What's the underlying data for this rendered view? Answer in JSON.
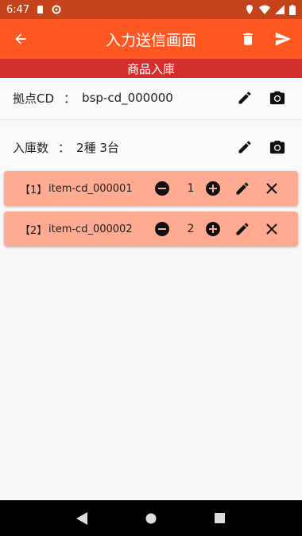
{
  "status_bar": {
    "time": "6:47",
    "icons": [
      "sd-card-icon",
      "data-saver-icon",
      "location-icon",
      "wifi-icon",
      "signal-icon",
      "battery-icon"
    ]
  },
  "app_bar": {
    "title": "入力送信画面",
    "back_icon": "arrow-back-icon",
    "delete_icon": "delete-icon",
    "send_icon": "send-icon",
    "color": "#ff5722"
  },
  "sub_header": {
    "title": "商品入庫",
    "color": "#d32f2f"
  },
  "base": {
    "label": "拠点CD",
    "colon": "：",
    "value": "bsp-cd_000000"
  },
  "stock": {
    "label": "入庫数",
    "colon": "：",
    "value": "2種 3台"
  },
  "items": [
    {
      "index": "【1】",
      "code": "item-cd_000001",
      "qty": "1"
    },
    {
      "index": "【2】",
      "code": "item-cd_000002",
      "qty": "2"
    }
  ],
  "item_card_color": "#ffab91",
  "nav_bar": {
    "icons": [
      "back-triangle-icon",
      "home-circle-icon",
      "recents-square-icon"
    ]
  }
}
